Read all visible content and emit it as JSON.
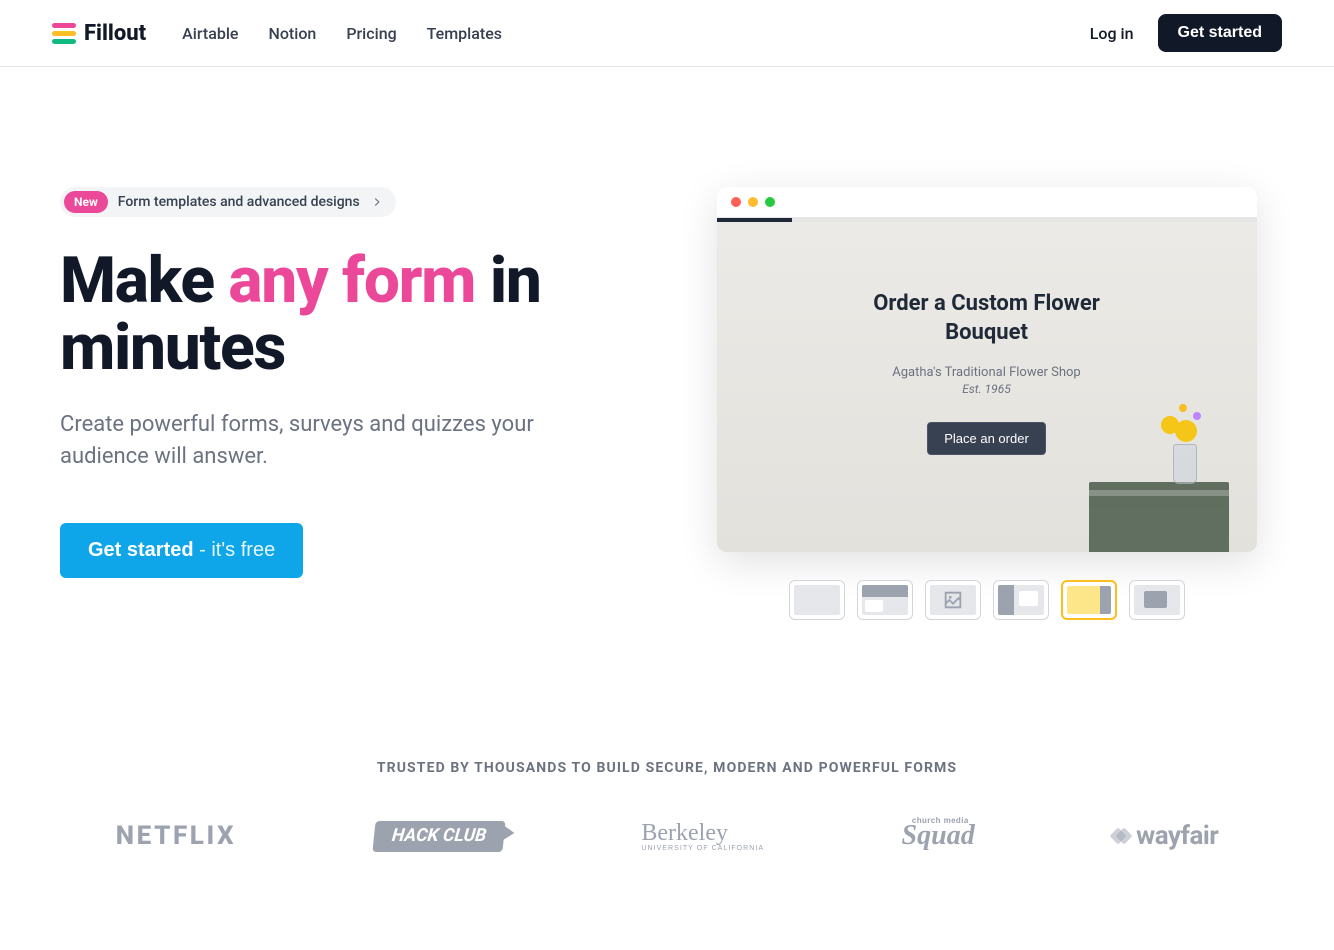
{
  "nav": {
    "brand": "Fillout",
    "links": [
      "Airtable",
      "Notion",
      "Pricing",
      "Templates"
    ],
    "login": "Log in",
    "get_started": "Get started"
  },
  "hero": {
    "badge": "New",
    "announcement": "Form templates and advanced designs",
    "headline_prefix": "Make ",
    "headline_accent": "any form",
    "headline_suffix": " in minutes",
    "subhead": "Create powerful forms, surveys and quizzes your audience will answer.",
    "cta_main": "Get started",
    "cta_suffix": " - it's free"
  },
  "preview": {
    "title": "Order a Custom Flower Bouquet",
    "shop": "Agatha's Traditional Flower Shop",
    "est": "Est. 1965",
    "button": "Place an order"
  },
  "trusted": {
    "headline": "TRUSTED BY THOUSANDS TO BUILD SECURE, MODERN AND POWERFUL FORMS",
    "logos": {
      "netflix": "NETFLIX",
      "hackclub": "HACK CLUB",
      "berkeley": "Berkeley",
      "berkeley_sub": "UNIVERSITY OF CALIFORNIA",
      "squad": "Squad",
      "squad_sub": "church media",
      "wayfair": "wayfair"
    }
  },
  "colors": {
    "accent_pink": "#ec4899",
    "cta_blue": "#0ea5e9",
    "thumb_active": "#fbbf24"
  }
}
